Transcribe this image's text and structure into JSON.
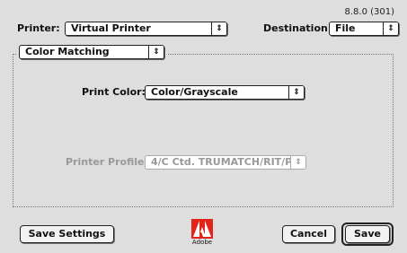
{
  "header": {
    "version": "8.8.0 (301)",
    "printer_label": "Printer:",
    "printer_value": "Virtual Printer",
    "destination_label": "Destination:",
    "destination_value": "File"
  },
  "panel": {
    "section_value": "Color Matching",
    "print_color_label": "Print Color:",
    "print_color_value": "Color/Grayscale",
    "printer_profile_label": "Printer Profile:",
    "printer_profile_value": "4/C Ctd. TRUMATCH/RIT/P..."
  },
  "footer": {
    "save_settings_label": "Save Settings",
    "logo_text": "Adobe",
    "cancel_label": "Cancel",
    "save_label": "Save"
  },
  "icons": {
    "popup_arrow": "updown-arrows-icon",
    "logo": "adobe-logo-icon"
  },
  "colors": {
    "logo_red": "#e3241b",
    "window_bg": "#dedede"
  }
}
